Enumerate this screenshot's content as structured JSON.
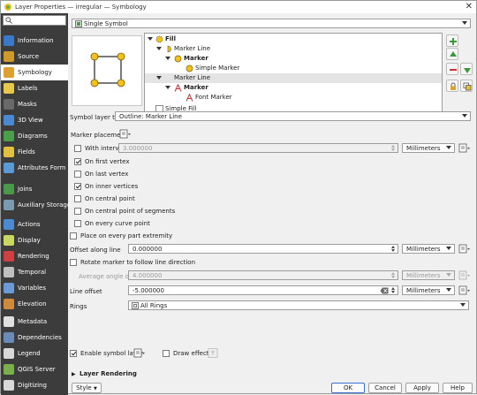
{
  "window": {
    "title": "Layer Properties — irregular — Symbology"
  },
  "sidebar": {
    "search_placeholder": "",
    "items": [
      {
        "label": "Information",
        "icon": "info-icon",
        "color": "#3a78c8"
      },
      {
        "label": "Source",
        "icon": "source-icon",
        "color": "#d09a2a"
      },
      {
        "label": "Symbology",
        "icon": "symbology-icon",
        "color": "#e0a030",
        "selected": true
      },
      {
        "label": "Labels",
        "icon": "labels-icon",
        "color": "#e8c84a"
      },
      {
        "label": "Masks",
        "icon": "masks-icon",
        "color": "#6a6a6a"
      },
      {
        "label": "3D View",
        "icon": "3d-view-icon",
        "color": "#4a8ad0"
      },
      {
        "label": "Diagrams",
        "icon": "diagrams-icon",
        "color": "#4aa04a"
      },
      {
        "label": "Fields",
        "icon": "fields-icon",
        "color": "#e0c040"
      },
      {
        "label": "Attributes Form",
        "icon": "attributes-form-icon",
        "color": "#5a9ad8"
      },
      {
        "label": "Joins",
        "icon": "joins-icon",
        "color": "#4a9a4a"
      },
      {
        "label": "Auxiliary Storage",
        "icon": "auxiliary-storage-icon",
        "color": "#7a9ab0"
      },
      {
        "label": "Actions",
        "icon": "actions-icon",
        "color": "#4a8ad0"
      },
      {
        "label": "Display",
        "icon": "display-icon",
        "color": "#c8d860"
      },
      {
        "label": "Rendering",
        "icon": "rendering-icon",
        "color": "#d04040"
      },
      {
        "label": "Temporal",
        "icon": "temporal-icon",
        "color": "#c0c0c0"
      },
      {
        "label": "Variables",
        "icon": "variables-icon",
        "color": "#6a9ad8"
      },
      {
        "label": "Elevation",
        "icon": "elevation-icon",
        "color": "#d08a3a"
      },
      {
        "label": "Metadata",
        "icon": "metadata-icon",
        "color": "#e0e0e0"
      },
      {
        "label": "Dependencies",
        "icon": "dependencies-icon",
        "color": "#6a8ab8"
      },
      {
        "label": "Legend",
        "icon": "legend-icon",
        "color": "#d8d8d8"
      },
      {
        "label": "QGIS Server",
        "icon": "qgis-server-icon",
        "color": "#7ab04a"
      },
      {
        "label": "Digitizing",
        "icon": "digitizing-icon",
        "color": "#d8d8d8"
      }
    ]
  },
  "renderer": {
    "value": "Single Symbol"
  },
  "tree": {
    "rows": [
      {
        "label": "Fill",
        "bold": true,
        "icon": "fill-icon"
      },
      {
        "label": "Marker Line",
        "bold": false,
        "icon": "marker-line-icon"
      },
      {
        "label": "Marker",
        "bold": true,
        "icon": "marker-icon"
      },
      {
        "label": "Simple Marker",
        "bold": false,
        "icon": "simple-marker-icon"
      },
      {
        "label": "Marker Line",
        "bold": false,
        "icon": "none"
      },
      {
        "label": "Marker",
        "bold": true,
        "icon": "font-marker-icon"
      },
      {
        "label": "Font Marker",
        "bold": false,
        "icon": "font-marker-icon"
      },
      {
        "label": "Simple Fill",
        "bold": false,
        "icon": "simple-fill-icon"
      }
    ]
  },
  "symbol_layer_type": {
    "label": "Symbol layer type",
    "value": "Outline: Marker Line"
  },
  "marker_placement": {
    "label": "Marker placement",
    "with_interval": {
      "label": "With interval",
      "value": "3.000000",
      "unit": "Millimeters",
      "checked": false
    },
    "on_first_vertex": {
      "label": "On first vertex",
      "checked": true
    },
    "on_last_vertex": {
      "label": "On last vertex",
      "checked": false
    },
    "on_inner_vertices": {
      "label": "On inner vertices",
      "checked": true
    },
    "on_central_point": {
      "label": "On central point",
      "checked": false
    },
    "on_central_point_of_segments": {
      "label": "On central point of segments",
      "checked": false
    },
    "on_every_curve_point": {
      "label": "On every curve point",
      "checked": false
    }
  },
  "place_on_every_part": {
    "label": "Place on every part extremity",
    "checked": false
  },
  "offset_along_line": {
    "label": "Offset along line",
    "value": "0.000000",
    "unit": "Millimeters"
  },
  "rotate_marker": {
    "label": "Rotate marker to follow line direction",
    "checked": false
  },
  "average_angle": {
    "label": "Average angle over",
    "value": "4.000000",
    "unit": "Millimeters"
  },
  "line_offset": {
    "label": "Line offset",
    "value": "-5.000000",
    "unit": "Millimeters"
  },
  "rings": {
    "label": "Rings",
    "value": "All Rings"
  },
  "enable_symbol_layer": {
    "label": "Enable symbol layer",
    "checked": true
  },
  "draw_effects": {
    "label": "Draw effects",
    "checked": false
  },
  "layer_rendering": {
    "label": "Layer Rendering"
  },
  "footer": {
    "style": "Style",
    "ok": "OK",
    "cancel": "Cancel",
    "apply": "Apply",
    "help": "Help"
  },
  "colors": {
    "sidebar_bg": "#3c3c3c",
    "marker_fill": "#f2c21b",
    "accent": "#3a6fd0"
  }
}
